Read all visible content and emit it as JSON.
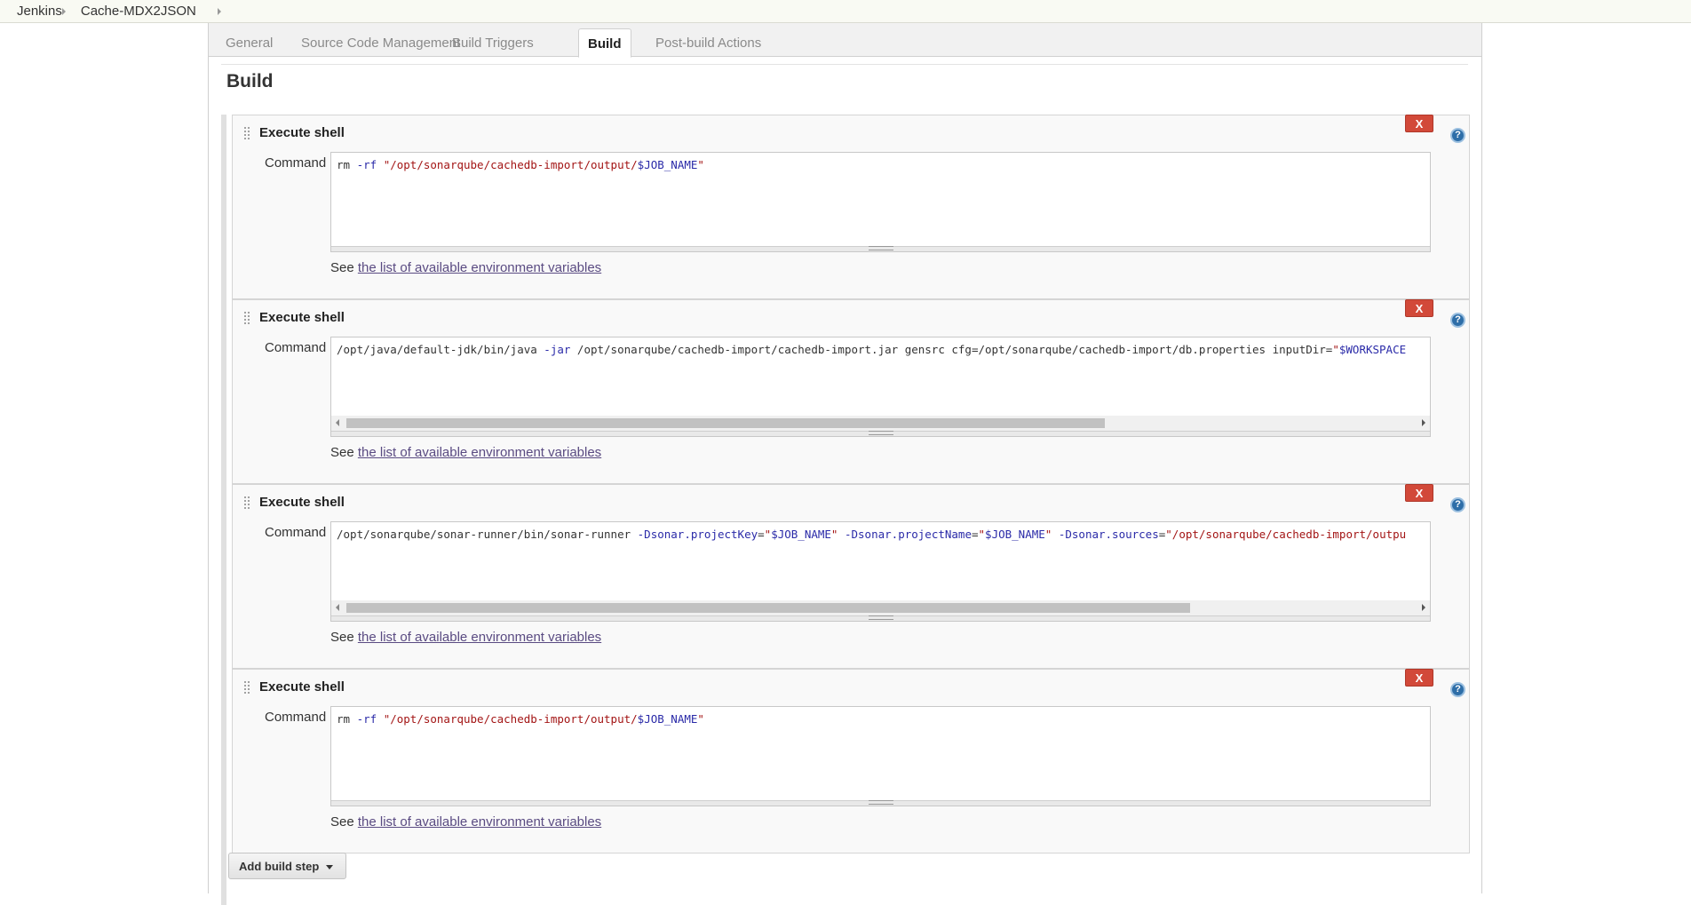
{
  "breadcrumb": [
    "Jenkins",
    "Cache-MDX2JSON"
  ],
  "tabs": [
    {
      "label": "General",
      "active": false
    },
    {
      "label": "Source Code Management",
      "active": false
    },
    {
      "label": "Build Triggers",
      "active": false
    },
    {
      "label": "Build",
      "active": true
    },
    {
      "label": "Post-build Actions",
      "active": false
    }
  ],
  "section_title": "Build",
  "steps": [
    {
      "title": "Execute shell",
      "command_label": "Command",
      "command": "rm -rf \"/opt/sonarqube/cachedb-import/output/$JOB_NAME\"",
      "see_prefix": "See ",
      "see_link": "the list of available environment variables",
      "delete_label": "X",
      "help_label": "?"
    },
    {
      "title": "Execute shell",
      "command_label": "Command",
      "command": "/opt/java/default-jdk/bin/java -jar /opt/sonarqube/cachedb-import/cachedb-import.jar gensrc cfg=/opt/sonarqube/cachedb-import/db.properties inputDir=\"$WORKSPACE",
      "scroll_fraction": 0.71,
      "see_prefix": "See ",
      "see_link": "the list of available environment variables",
      "delete_label": "X",
      "help_label": "?"
    },
    {
      "title": "Execute shell",
      "command_label": "Command",
      "command": "/opt/sonarqube/sonar-runner/bin/sonar-runner -Dsonar.projectKey=\"$JOB_NAME\" -Dsonar.projectName=\"$JOB_NAME\" -Dsonar.sources=\"/opt/sonarqube/cachedb-import/outpu",
      "scroll_fraction": 0.79,
      "see_prefix": "See ",
      "see_link": "the list of available environment variables",
      "delete_label": "X",
      "help_label": "?"
    },
    {
      "title": "Execute shell",
      "command_label": "Command",
      "command": "rm -rf \"/opt/sonarqube/cachedb-import/output/$JOB_NAME\"",
      "see_prefix": "See ",
      "see_link": "the list of available environment variables",
      "delete_label": "X",
      "help_label": "?"
    }
  ],
  "add_build_step_label": "Add build step",
  "colors": {
    "delete_button": "#d24939",
    "help_icon": "#2e6ea8",
    "link": "#5a4b82",
    "keyword": "#2a2aa8",
    "string": "#a31515"
  }
}
